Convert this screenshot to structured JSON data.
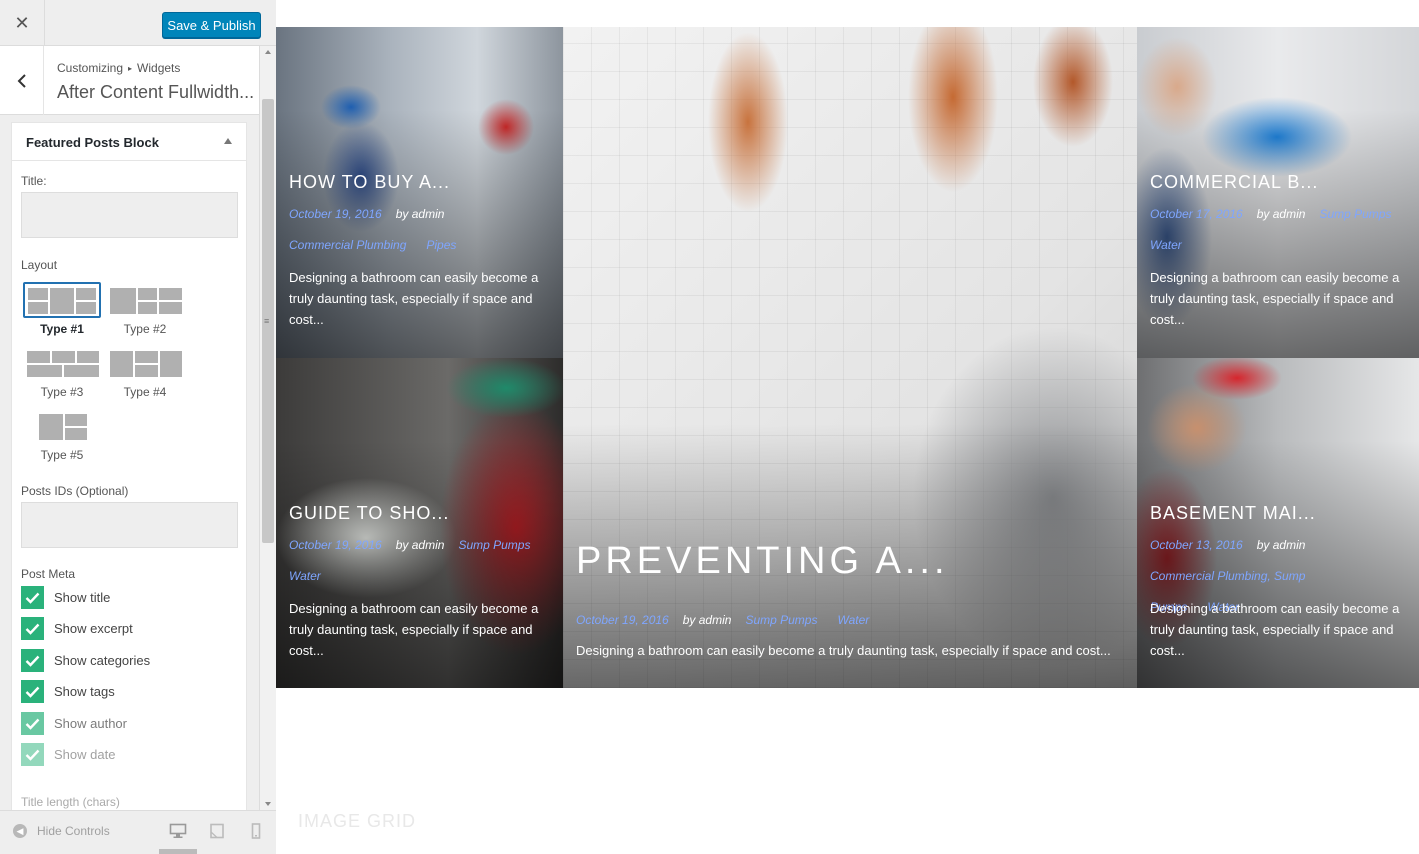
{
  "topbar": {
    "close_icon": "close-icon",
    "publish_label": "Save & Publish"
  },
  "section": {
    "breadcrumb_root": "Customizing",
    "breadcrumb_separator": "▸",
    "breadcrumb_child": "Widgets",
    "title": "After Content Fullwidth..."
  },
  "widget": {
    "title": "Featured Posts Block",
    "title_label": "Title:",
    "title_value": "",
    "layout_label": "Layout",
    "layouts": [
      "Type #1",
      "Type #2",
      "Type #3",
      "Type #4",
      "Type #5"
    ],
    "selected_layout": "Type #1",
    "post_ids_label": "Posts IDs (Optional)",
    "post_ids_value": "",
    "post_meta_label": "Post Meta",
    "checkboxes": [
      {
        "label": "Show title",
        "checked": true
      },
      {
        "label": "Show excerpt",
        "checked": true
      },
      {
        "label": "Show categories",
        "checked": true
      },
      {
        "label": "Show tags",
        "checked": true
      },
      {
        "label": "Show author",
        "checked": true
      },
      {
        "label": "Show date",
        "checked": true
      }
    ],
    "title_length_label": "Title length (chars)"
  },
  "bottom": {
    "hide_controls": "Hide Controls"
  },
  "preview": {
    "posts": [
      {
        "title": "HOW TO BUY A...",
        "date": "October 19, 2016",
        "author": "by admin",
        "categories": [
          "Commercial Plumbing",
          "Pipes"
        ],
        "excerpt": "Designing a bathroom can easily become a truly daunting task, especially if space and cost..."
      },
      {
        "title": "PREVENTING A...",
        "date": "October 19, 2016",
        "author": "by admin",
        "categories": [
          "Sump Pumps",
          "Water"
        ],
        "excerpt": "Designing a bathroom can easily become a truly daunting task, especially if space and cost..."
      },
      {
        "title": "COMMERCIAL B...",
        "date": "October 17, 2016",
        "author": "by admin",
        "categories": [
          "Sump Pumps",
          "Water"
        ],
        "excerpt": "Designing a bathroom can easily become a truly daunting task, especially if space and cost..."
      },
      {
        "title": "GUIDE TO SHO...",
        "date": "October 19, 2016",
        "author": "by admin",
        "categories": [
          "Sump Pumps",
          "Water"
        ],
        "excerpt": "Designing a bathroom can easily become a truly daunting task, especially if space and cost..."
      },
      {
        "title": "BASEMENT MAI...",
        "date": "October 13, 2016",
        "author": "by admin",
        "categories": [
          "Commercial Plumbing, Sump Pumps",
          "Water"
        ],
        "excerpt": "Designing a bathroom can easily become a truly daunting task, especially if space and cost..."
      }
    ],
    "next_section_label": "IMAGE GRID"
  }
}
